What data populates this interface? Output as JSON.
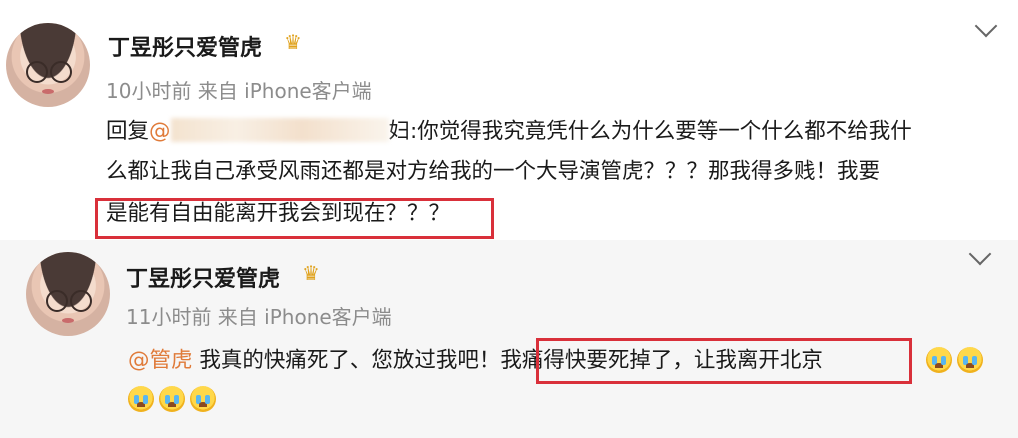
{
  "top_comment": {
    "author": "丁昱彤只爱管虎",
    "meta": "10小时前 来自 iPhone客户端",
    "reply_prefix": "回复",
    "reply_mention": "@",
    "line1_rest": "妇:你觉得我究竟凭什么为什么要等一个什么都不给我什",
    "line2": "么都让我自己承受风雨还都是对方给我的一个大导演管虎？？？那我得多贱！我要",
    "line3": "是能有自由能离开我会到现在？？？"
  },
  "reply_comment": {
    "author": "丁昱彤只爱管虎",
    "meta": "11小时前 来自 iPhone客户端",
    "mention": "@管虎",
    "text_a": " 我真的快痛死了、您放过我吧！",
    "text_b": "我痛得快要死掉了，让我离开北京"
  },
  "icons": {
    "crown": "♛",
    "emoji_name": "crying-face-icon"
  },
  "colors": {
    "mention": "#e07b3a",
    "highlight_border": "#d9303a",
    "crown": "#e0a21c"
  }
}
